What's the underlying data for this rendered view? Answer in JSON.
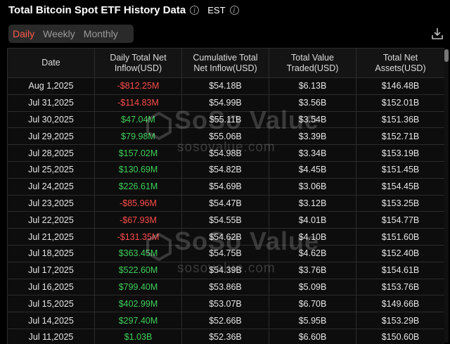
{
  "header": {
    "title": "Total Bitcoin Spot ETF History Data",
    "timezone": "EST"
  },
  "tabs": [
    {
      "label": "Daily",
      "active": true
    },
    {
      "label": "Weekly",
      "active": false
    },
    {
      "label": "Monthly",
      "active": false
    }
  ],
  "watermark": {
    "brand": "SoSo Value",
    "url": "sosovalue.com"
  },
  "table": {
    "columns": [
      "Date",
      "Daily Total Net Inflow(USD)",
      "Cumulative Total Net Inflow(USD)",
      "Total Value Traded(USD)",
      "Total Net Assets(USD)"
    ],
    "rows": [
      {
        "date": "Aug 1,2025",
        "daily": "-$812.25M",
        "cumulative": "$54.18B",
        "traded": "$6.13B",
        "assets": "$146.48B"
      },
      {
        "date": "Jul 31,2025",
        "daily": "-$114.83M",
        "cumulative": "$54.99B",
        "traded": "$3.56B",
        "assets": "$152.01B"
      },
      {
        "date": "Jul 30,2025",
        "daily": "$47.04M",
        "cumulative": "$55.11B",
        "traded": "$3.54B",
        "assets": "$151.36B"
      },
      {
        "date": "Jul 29,2025",
        "daily": "$79.98M",
        "cumulative": "$55.06B",
        "traded": "$3.39B",
        "assets": "$152.71B"
      },
      {
        "date": "Jul 28,2025",
        "daily": "$157.02M",
        "cumulative": "$54.98B",
        "traded": "$3.34B",
        "assets": "$153.19B"
      },
      {
        "date": "Jul 25,2025",
        "daily": "$130.69M",
        "cumulative": "$54.82B",
        "traded": "$4.45B",
        "assets": "$151.45B"
      },
      {
        "date": "Jul 24,2025",
        "daily": "$226.61M",
        "cumulative": "$54.69B",
        "traded": "$3.06B",
        "assets": "$154.45B"
      },
      {
        "date": "Jul 23,2025",
        "daily": "-$85.96M",
        "cumulative": "$54.47B",
        "traded": "$3.12B",
        "assets": "$153.25B"
      },
      {
        "date": "Jul 22,2025",
        "daily": "-$67.93M",
        "cumulative": "$54.55B",
        "traded": "$4.01B",
        "assets": "$154.77B"
      },
      {
        "date": "Jul 21,2025",
        "daily": "-$131.35M",
        "cumulative": "$54.62B",
        "traded": "$4.10B",
        "assets": "$151.60B"
      },
      {
        "date": "Jul 18,2025",
        "daily": "$363.45M",
        "cumulative": "$54.75B",
        "traded": "$4.62B",
        "assets": "$152.40B"
      },
      {
        "date": "Jul 17,2025",
        "daily": "$522.60M",
        "cumulative": "$54.39B",
        "traded": "$3.76B",
        "assets": "$154.61B"
      },
      {
        "date": "Jul 16,2025",
        "daily": "$799.40M",
        "cumulative": "$53.86B",
        "traded": "$5.09B",
        "assets": "$153.76B"
      },
      {
        "date": "Jul 15,2025",
        "daily": "$402.99M",
        "cumulative": "$53.07B",
        "traded": "$6.70B",
        "assets": "$149.66B"
      },
      {
        "date": "Jul 14,2025",
        "daily": "$297.40M",
        "cumulative": "$52.66B",
        "traded": "$5.95B",
        "assets": "$153.29B"
      },
      {
        "date": "Jul 11,2025",
        "daily": "$1.03B",
        "cumulative": "$52.36B",
        "traded": "$6.60B",
        "assets": "$150.60B"
      }
    ]
  },
  "icons": {
    "info": "info-icon",
    "download": "download-icon"
  },
  "colors": {
    "positive": "#3fcf5a",
    "negative": "#ff4b4b",
    "active_tab": "#ff5a4a"
  }
}
